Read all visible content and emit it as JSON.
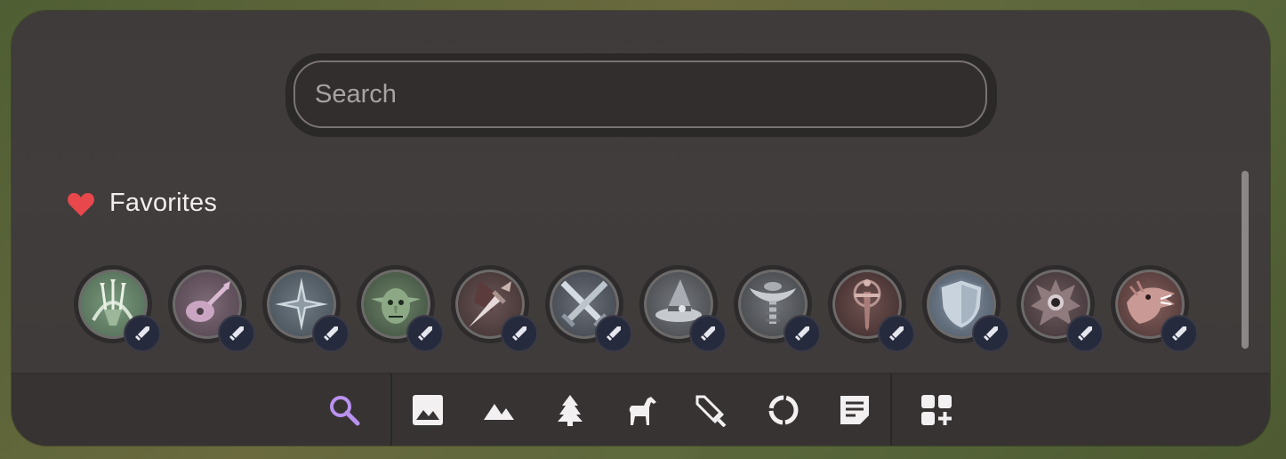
{
  "search": {
    "placeholder": "Search",
    "value": ""
  },
  "favorites": {
    "title": "Favorites",
    "heart_color": "#e8474c",
    "tokens": [
      {
        "icon": "ranger-bow-icon",
        "color": "#5d7b60"
      },
      {
        "icon": "bard-lute-icon",
        "color": "#6e5a66"
      },
      {
        "icon": "compass-star-icon",
        "color": "#56636b"
      },
      {
        "icon": "goblin-head-icon",
        "color": "#4f6650"
      },
      {
        "icon": "rogue-dagger-icon",
        "color": "#6a5050"
      },
      {
        "icon": "crossed-swords-icon",
        "color": "#535964"
      },
      {
        "icon": "wizard-hat-icon",
        "color": "#585a5f"
      },
      {
        "icon": "cleric-mace-icon",
        "color": "#575a5e"
      },
      {
        "icon": "paladin-sword-icon",
        "color": "#5e4746"
      },
      {
        "icon": "shield-icon",
        "color": "#5f6d7d"
      },
      {
        "icon": "spiked-gem-icon",
        "color": "#5a4a4e"
      },
      {
        "icon": "dragon-head-icon",
        "color": "#6d4f4e"
      }
    ],
    "badge_icon": "sword-badge-icon"
  },
  "toolbar": {
    "active_color": "#b992f0",
    "items": [
      {
        "name": "search",
        "icon": "search-icon",
        "active": true
      },
      {
        "name": "image",
        "icon": "image-icon"
      },
      {
        "name": "terrain",
        "icon": "mountain-icon"
      },
      {
        "name": "trees",
        "icon": "tree-icon"
      },
      {
        "name": "creatures",
        "icon": "horse-icon"
      },
      {
        "name": "items",
        "icon": "sword-icon"
      },
      {
        "name": "effects",
        "icon": "ring-icon"
      },
      {
        "name": "notes",
        "icon": "note-icon"
      },
      {
        "name": "add",
        "icon": "add-widget-icon"
      }
    ]
  }
}
